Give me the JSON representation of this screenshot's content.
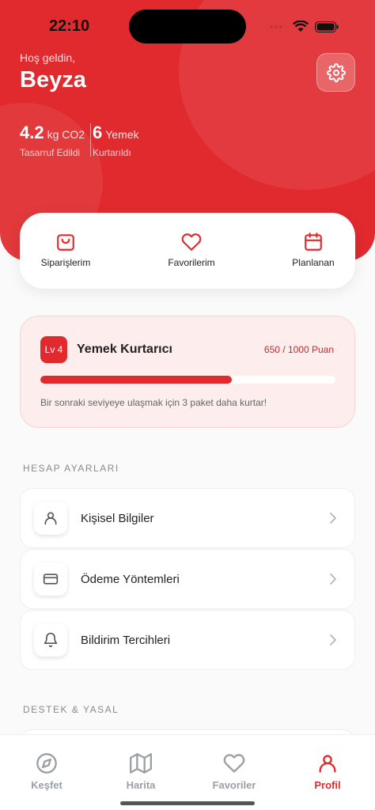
{
  "status_bar": {
    "time": "22:10"
  },
  "header": {
    "welcome": "Hoş geldin,",
    "username": "Beyza",
    "stats": [
      {
        "value": "4.2",
        "unit": "kg CO2",
        "label": "Tasarruf Edildi"
      },
      {
        "value": "6",
        "unit": "Yemek",
        "label": "Kurtarıldı"
      }
    ]
  },
  "quick_actions": [
    {
      "label": "Siparişlerim",
      "icon": "shopping-bag-icon"
    },
    {
      "label": "Favorilerim",
      "icon": "heart-icon"
    },
    {
      "label": "Planlanan",
      "icon": "calendar-icon"
    }
  ],
  "level": {
    "badge": "Lv 4",
    "title": "Yemek Kurtarıcı",
    "points": "650 / 1000 Puan",
    "progress": 0.65,
    "hint": "Bir sonraki seviyeye ulaşmak için 3 paket daha kurtar!"
  },
  "account_section": {
    "title": "HESAP AYARLARI",
    "items": [
      {
        "label": "Kişisel Bilgiler",
        "icon": "user-icon"
      },
      {
        "label": "Ödeme Yöntemleri",
        "icon": "credit-card-icon"
      },
      {
        "label": "Bildirim Tercihleri",
        "icon": "bell-icon"
      }
    ]
  },
  "support_section": {
    "title": "DESTEK & YASAL"
  },
  "tabbar": {
    "items": [
      {
        "label": "Keşfet",
        "icon": "compass-icon"
      },
      {
        "label": "Harita",
        "icon": "map-icon"
      },
      {
        "label": "Favoriler",
        "icon": "heart-icon"
      },
      {
        "label": "Profil",
        "icon": "user-icon"
      }
    ],
    "active": "Profil"
  },
  "colors": {
    "primary": "#e02a2e",
    "muted": "#9aa0a6"
  }
}
